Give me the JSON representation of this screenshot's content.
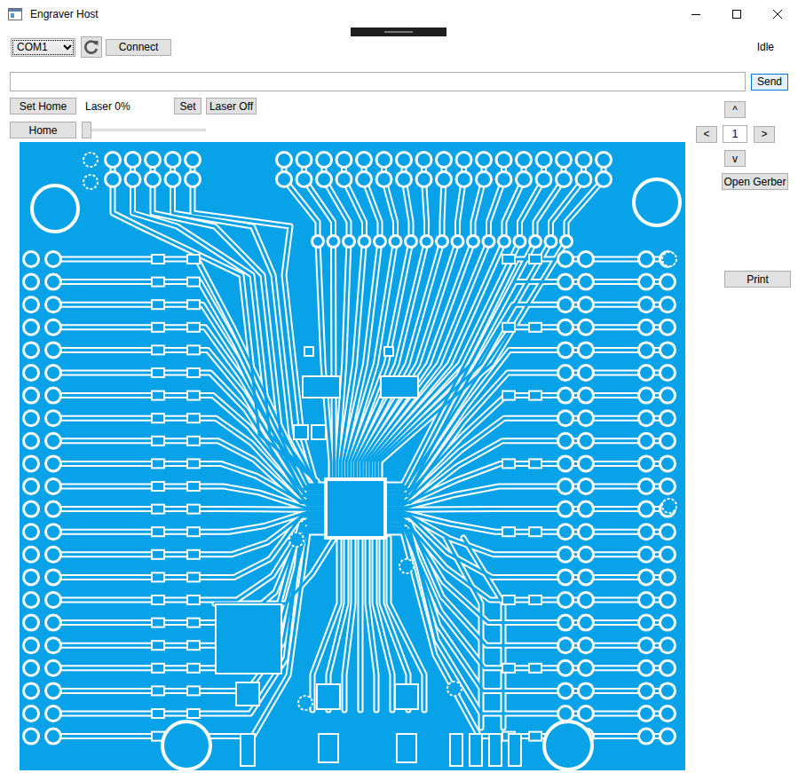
{
  "window": {
    "title": "Engraver Host"
  },
  "connection": {
    "port": "COM1",
    "connect": "Connect",
    "status": "Idle"
  },
  "command": {
    "value": "",
    "send": "Send"
  },
  "laser": {
    "set_home": "Set Home",
    "home": "Home",
    "label": "Laser 0%",
    "level": 0,
    "set": "Set",
    "off": "Laser Off"
  },
  "jog": {
    "up": "^",
    "left": "<",
    "step": "1",
    "right": ">",
    "down": "v"
  },
  "actions": [
    "Open Gerber",
    "Print"
  ]
}
